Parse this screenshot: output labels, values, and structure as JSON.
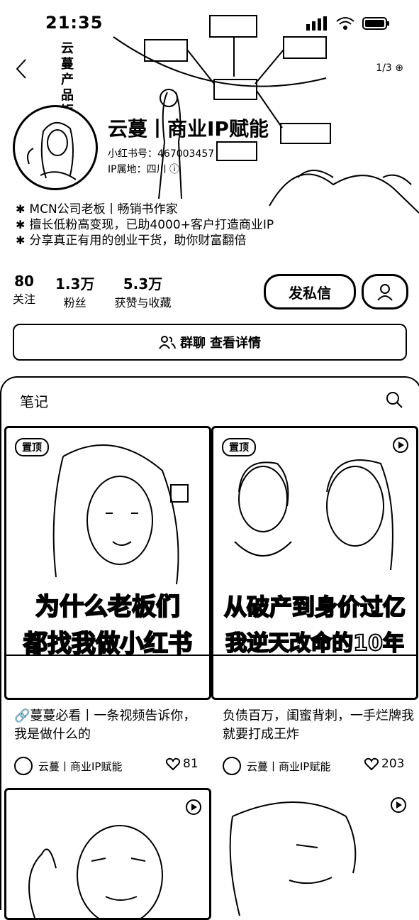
{
  "status_bar": {
    "time": "21:35"
  },
  "header": {
    "vertical_title": "云蔓产品矩",
    "top_right": "1/3 ⊕",
    "nickname": "云蔓丨商业IP赋能",
    "account_id": "小红书号：467003457",
    "ip_location": "IP属地：四川 ⓘ",
    "bio": [
      "MCN公司老板丨畅销书作家",
      "擅长低粉高变现，已助4000+客户打造商业IP",
      "分享真正有用的创业干货，助你财富翻倍"
    ]
  },
  "stats": [
    {
      "num": "80",
      "label": "关注"
    },
    {
      "num": "1.3万",
      "label": "粉丝"
    },
    {
      "num": "5.3万",
      "label": "获赞与收藏"
    }
  ],
  "actions": {
    "message": "发私信"
  },
  "group_chat": {
    "label": "群聊",
    "action": "查看详情"
  },
  "notes": {
    "tab": "笔记",
    "cards": [
      {
        "pin": "置顶",
        "caption_top": "为什么老板们",
        "caption_bottom": "都找我做小红书",
        "title": "🔗蔓蔓必看丨一条视频告诉你，我是做什么的",
        "author": "云蔓丨商业IP赋能",
        "likes": "81"
      },
      {
        "pin": "置顶",
        "caption_top": "从破产到身价过亿",
        "caption_bottom": "我逆天改命的10年",
        "title": "负债百万，闺蜜背刺，一手烂牌我就要打成王炸",
        "author": "云蔓丨商业IP赋能",
        "likes": "203"
      }
    ]
  }
}
